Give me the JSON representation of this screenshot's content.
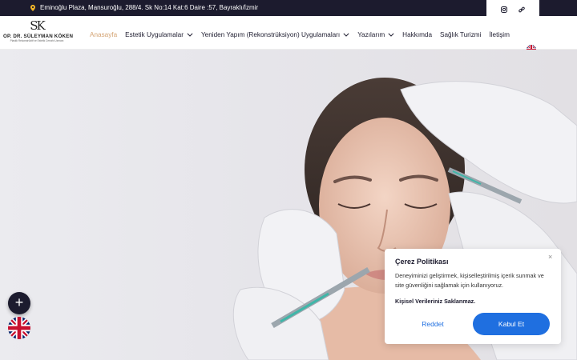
{
  "topbar": {
    "address": "Eminoğlu Plaza, Mansuroğlu, 288/4. Sk No:14 Kat:6 Daire :57, Bayraklı/İzmir",
    "address_icon": "location-pin-icon",
    "social_icons": [
      "instagram-icon",
      "link-icon"
    ]
  },
  "logo": {
    "monogram": "SK",
    "name": "OP. DR. SÜLEYMAN KÖKEN",
    "tagline": "Plastik Rekonstrüktif ve Estetik Cerrahi Uzmanı"
  },
  "nav": {
    "items": [
      {
        "label": "Anasayfa",
        "active": true,
        "dropdown": false
      },
      {
        "label": "Estetik Uygulamalar",
        "active": false,
        "dropdown": true
      },
      {
        "label": "Yeniden Yapım (Rekonstrüksiyon) Uygulamaları",
        "active": false,
        "dropdown": true
      },
      {
        "label": "Yazılarım",
        "active": false,
        "dropdown": true
      },
      {
        "label": "Hakkımda",
        "active": false,
        "dropdown": false
      },
      {
        "label": "Sağlık Turizmi",
        "active": false,
        "dropdown": false
      },
      {
        "label": "İletişim",
        "active": false,
        "dropdown": false
      }
    ],
    "language_icon": "uk-flag-icon"
  },
  "fab": {
    "label": "+"
  },
  "cookie": {
    "title": "Çerez Politikası",
    "text": "Deneyiminizi geliştirmek, kişiselleştirilmiş içerik sunmak ve site güvenliğini sağlamak için kullanıyoruz.",
    "link": "Kişisel Verileriniz Saklanmaz.",
    "reject": "Reddet",
    "accept": "Kabul Et",
    "close": "×"
  },
  "colors": {
    "brand_dark": "#1c1b2e",
    "accent_gold": "#d4a373",
    "button_blue": "#1f6fe0"
  }
}
